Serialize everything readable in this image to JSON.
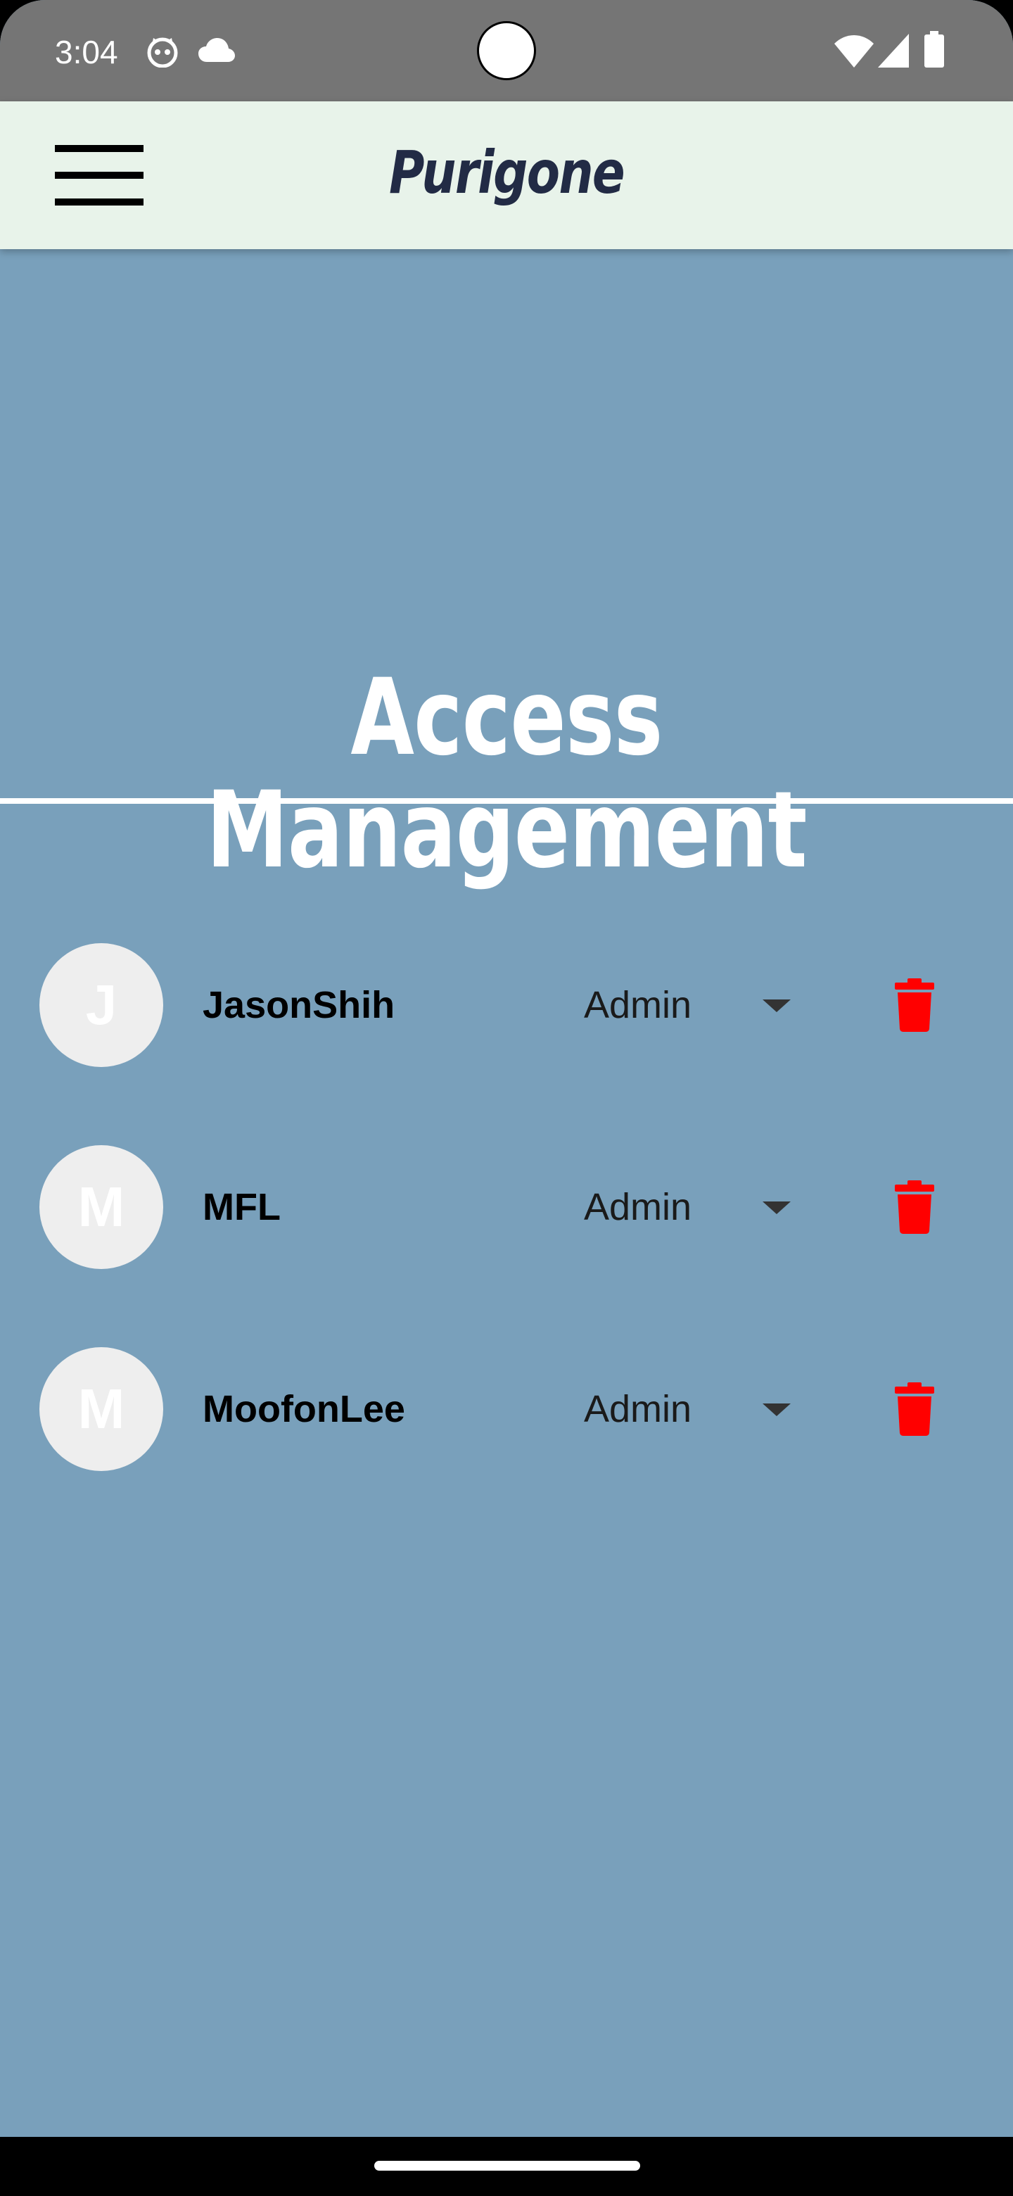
{
  "status_bar": {
    "time": "3:04",
    "left_icons": [
      "cat-face-icon",
      "cloud-icon"
    ],
    "right_icons": [
      "wifi-icon",
      "signal-icon",
      "battery-icon"
    ]
  },
  "app_bar": {
    "title": "Purigone",
    "menu_icon": "hamburger-menu-icon",
    "background": "#e8f3ea",
    "title_color": "#222b45"
  },
  "page": {
    "title": "Access Management",
    "background": "#79a0bb"
  },
  "users": [
    {
      "initial": "J",
      "name": "JasonShih",
      "role": "Admin"
    },
    {
      "initial": "M",
      "name": "MFL",
      "role": "Admin"
    },
    {
      "initial": "M",
      "name": "MoofonLee",
      "role": "Admin"
    }
  ],
  "icons": {
    "delete": "trash-icon",
    "dropdown": "caret-down-icon",
    "delete_color": "#ff0000"
  }
}
